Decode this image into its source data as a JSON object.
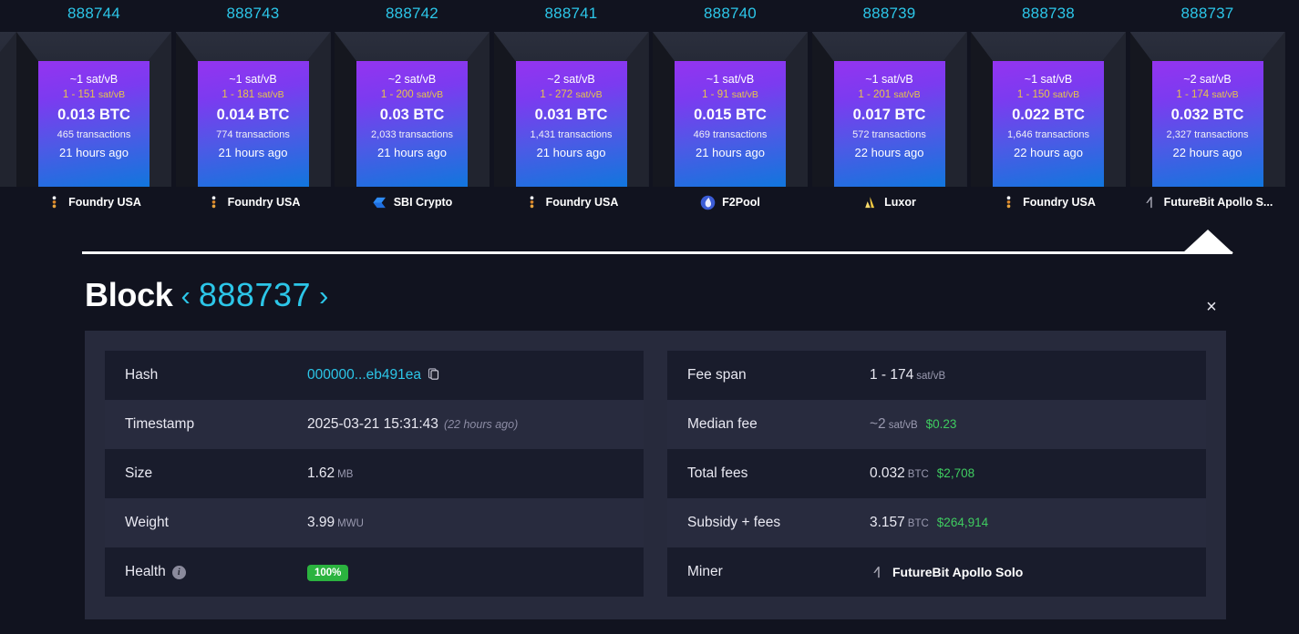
{
  "blocks": [
    {
      "height": "888744",
      "fee_avg": "~1 sat/vB",
      "fee_span": "1 - 151",
      "fee_span_unit": "sat/vB",
      "btc": "0.013 BTC",
      "txs": "465 transactions",
      "ago": "21 hours ago",
      "pool": "Foundry USA",
      "pool_icon": "foundry-usa-icon",
      "selected": false
    },
    {
      "height": "888743",
      "fee_avg": "~1 sat/vB",
      "fee_span": "1 - 181",
      "fee_span_unit": "sat/vB",
      "btc": "0.014 BTC",
      "txs": "774 transactions",
      "ago": "21 hours ago",
      "pool": "Foundry USA",
      "pool_icon": "foundry-usa-icon",
      "selected": false
    },
    {
      "height": "888742",
      "fee_avg": "~2 sat/vB",
      "fee_span": "1 - 200",
      "fee_span_unit": "sat/vB",
      "btc": "0.03 BTC",
      "txs": "2,033 transactions",
      "ago": "21 hours ago",
      "pool": "SBI Crypto",
      "pool_icon": "sbi-crypto-icon",
      "selected": false
    },
    {
      "height": "888741",
      "fee_avg": "~2 sat/vB",
      "fee_span": "1 - 272",
      "fee_span_unit": "sat/vB",
      "btc": "0.031 BTC",
      "txs": "1,431 transactions",
      "ago": "21 hours ago",
      "pool": "Foundry USA",
      "pool_icon": "foundry-usa-icon",
      "selected": false
    },
    {
      "height": "888740",
      "fee_avg": "~1 sat/vB",
      "fee_span": "1 - 91",
      "fee_span_unit": "sat/vB",
      "btc": "0.015 BTC",
      "txs": "469 transactions",
      "ago": "21 hours ago",
      "pool": "F2Pool",
      "pool_icon": "f2pool-icon",
      "selected": false
    },
    {
      "height": "888739",
      "fee_avg": "~1 sat/vB",
      "fee_span": "1 - 201",
      "fee_span_unit": "sat/vB",
      "btc": "0.017 BTC",
      "txs": "572 transactions",
      "ago": "22 hours ago",
      "pool": "Luxor",
      "pool_icon": "luxor-icon",
      "selected": false
    },
    {
      "height": "888738",
      "fee_avg": "~1 sat/vB",
      "fee_span": "1 - 150",
      "fee_span_unit": "sat/vB",
      "btc": "0.022 BTC",
      "txs": "1,646 transactions",
      "ago": "22 hours ago",
      "pool": "Foundry USA",
      "pool_icon": "foundry-usa-icon",
      "selected": false
    },
    {
      "height": "888737",
      "fee_avg": "~2 sat/vB",
      "fee_span": "1 - 174",
      "fee_span_unit": "sat/vB",
      "btc": "0.032 BTC",
      "txs": "2,327 transactions",
      "ago": "22 hours ago",
      "pool": "FutureBit Apollo S...",
      "pool_icon": "futurebit-apollo-icon",
      "selected": true
    }
  ],
  "panel": {
    "title": "Block",
    "block_number": "888737",
    "prev_chevron": "‹",
    "next_chevron": "›",
    "close_label": "×",
    "left_rows": [
      {
        "label": "Hash",
        "value": "000000...eb491ea",
        "kind": "hash",
        "copy_icon": "copy-to-clipboard-icon"
      },
      {
        "label": "Timestamp",
        "value": "2025-03-21 15:31:43",
        "suffix": "(22 hours ago)",
        "kind": "timestamp"
      },
      {
        "label": "Size",
        "value": "1.62",
        "unit": "MB",
        "kind": "unit"
      },
      {
        "label": "Weight",
        "value": "3.99",
        "unit": "MWU",
        "kind": "unit"
      },
      {
        "label": "Health",
        "value": "100%",
        "kind": "health",
        "info_icon": "info-icon"
      }
    ],
    "right_rows": [
      {
        "label": "Fee span",
        "value": "1 - 174",
        "unit": "sat/vB",
        "kind": "unit"
      },
      {
        "label": "Median fee",
        "value": "~2",
        "unit": "sat/vB",
        "fiat": "$0.23",
        "kind": "fee-muted"
      },
      {
        "label": "Total fees",
        "value": "0.032",
        "unit": "BTC",
        "fiat": "$2,708",
        "kind": "fee"
      },
      {
        "label": "Subsidy + fees",
        "value": "3.157",
        "unit": "BTC",
        "fiat": "$264,914",
        "kind": "fee"
      },
      {
        "label": "Miner",
        "value": "FutureBit Apollo Solo",
        "kind": "miner",
        "pool_icon": "futurebit-apollo-icon"
      }
    ]
  },
  "colors": {
    "accent_cyan": "#2cc6e8",
    "fee_yellow": "#e8c64a",
    "fiat_green": "#3fcc60",
    "health_green": "#2bb33f",
    "panel_bg": "#272a3c",
    "page_bg": "#11131f",
    "block_gradient_start": "#9434f0",
    "block_gradient_end": "#1176dd"
  }
}
